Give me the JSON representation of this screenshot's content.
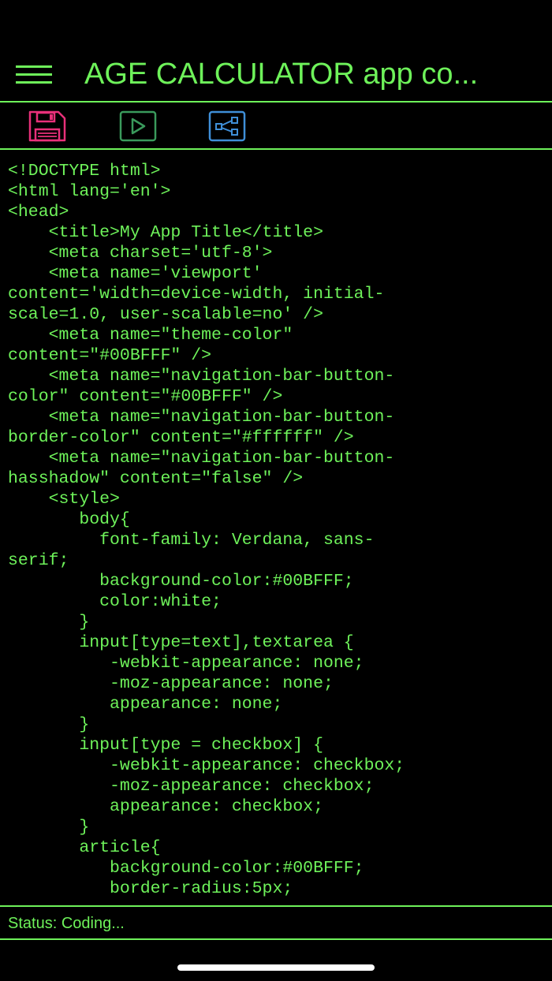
{
  "header": {
    "title": "AGE CALCULATOR app co...",
    "menu_icon": "hamburger-menu-icon"
  },
  "toolbar": {
    "buttons": [
      {
        "icon": "save-icon",
        "color": "#e8307a"
      },
      {
        "icon": "play-icon",
        "color": "#3a9a5c"
      },
      {
        "icon": "share-icon",
        "color": "#3f8fd8"
      }
    ]
  },
  "editor": {
    "lines": [
      "<!DOCTYPE html>",
      "<html lang='en'>",
      "<head>",
      "    <title>My App Title</title>",
      "    <meta charset='utf-8'>",
      "    <meta name='viewport'",
      "content='width=device-width, initial-",
      "scale=1.0, user-scalable=no' />",
      "    <meta name=\"theme-color\"",
      "content=\"#00BFFF\" />",
      "    <meta name=\"navigation-bar-button-",
      "color\" content=\"#00BFFF\" />",
      "    <meta name=\"navigation-bar-button-",
      "border-color\" content=\"#ffffff\" />",
      "    <meta name=\"navigation-bar-button-",
      "hasshadow\" content=\"false\" />",
      "    <style>",
      "       body{",
      "         font-family: Verdana, sans-",
      "serif;",
      "         background-color:#00BFFF;",
      "         color:white;",
      "       }",
      "       input[type=text],textarea {",
      "          -webkit-appearance: none;",
      "          -moz-appearance: none;",
      "          appearance: none;",
      "       }",
      "       input[type = checkbox] {",
      "          -webkit-appearance: checkbox;",
      "          -moz-appearance: checkbox;",
      "          appearance: checkbox;",
      "       }",
      "       article{",
      "          background-color:#00BFFF;",
      "          border-radius:5px;"
    ]
  },
  "status": {
    "text": "Status: Coding..."
  },
  "colors": {
    "accent": "#6ef25a",
    "background": "#000000"
  }
}
